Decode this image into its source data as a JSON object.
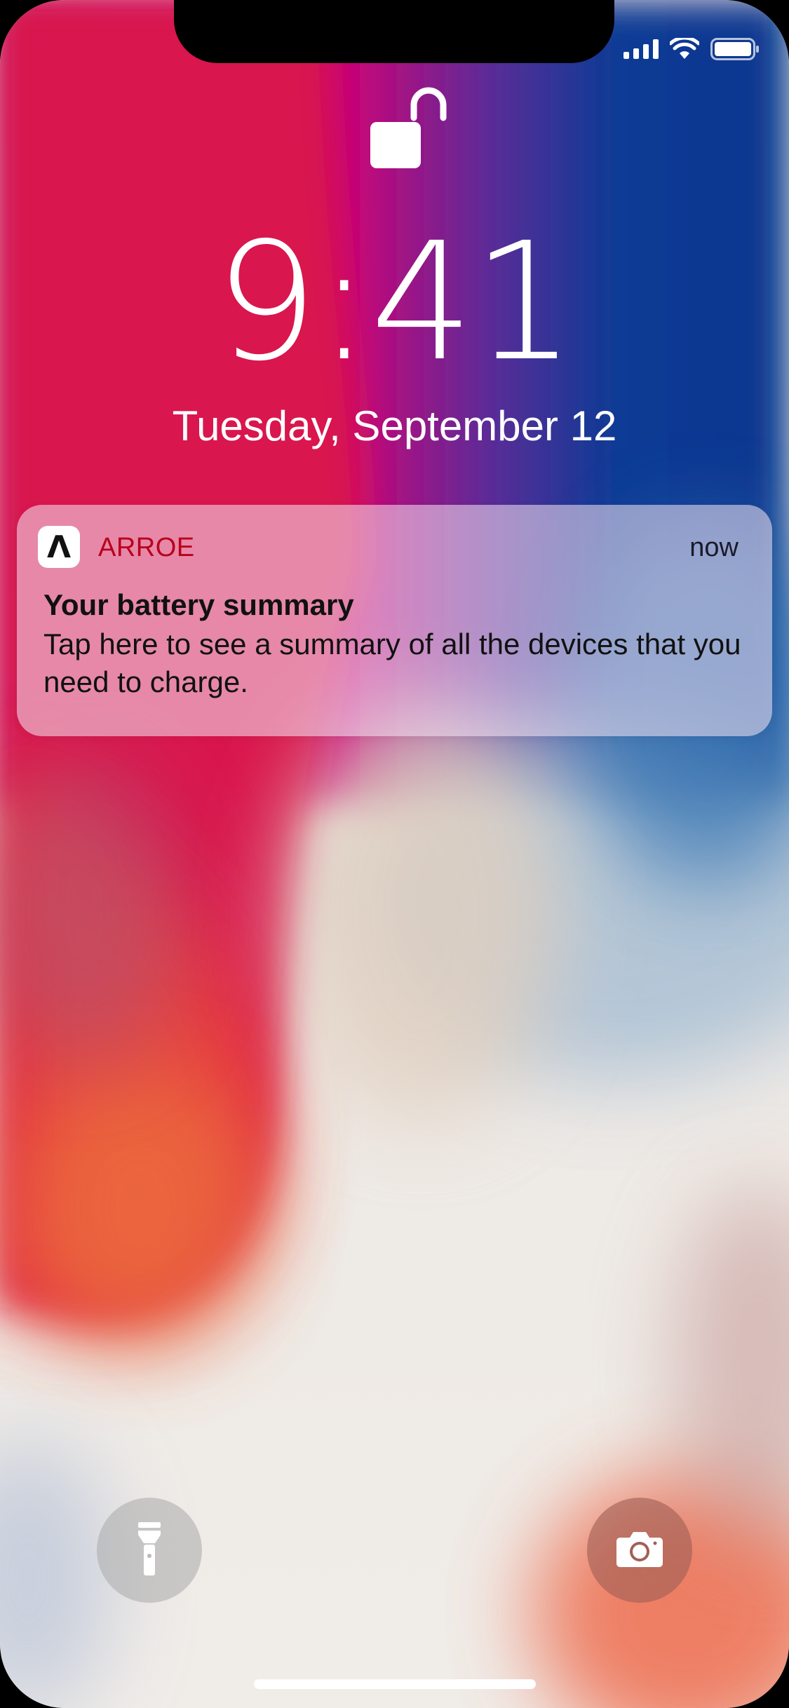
{
  "status_bar": {
    "signal_icon": "cellular-signal-icon",
    "wifi_icon": "wifi-icon",
    "battery_icon": "battery-icon"
  },
  "lock_screen": {
    "lock_icon": "unlocked-padlock-icon",
    "time": "9:41",
    "date": "Tuesday, September 12"
  },
  "notification": {
    "app_icon_glyph": "Λ",
    "app_name": "ARROE",
    "timestamp": "now",
    "title": "Your battery summary",
    "body": "Tap here to see a summary of all the devices that you need to charge."
  },
  "quick_actions": {
    "flashlight_icon": "flashlight-icon",
    "camera_icon": "camera-icon"
  },
  "colors": {
    "app_name": "#b8001c",
    "text": "#111111",
    "white": "#ffffff"
  }
}
